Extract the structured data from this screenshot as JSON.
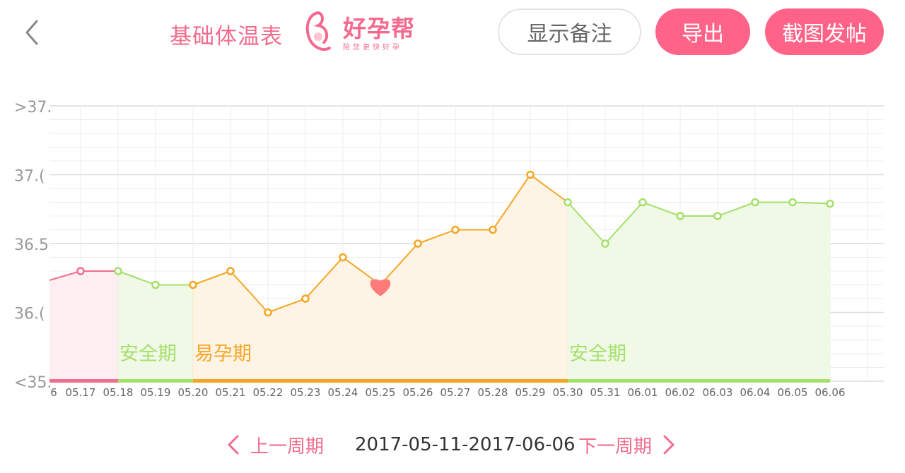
{
  "header": {
    "title": "基础体温表",
    "logo_text": "好孕帮",
    "logo_slogan": "陪您更快好孕",
    "show_notes_label": "显示备注",
    "export_label": "导出",
    "screenshot_post_label": "截图发帖"
  },
  "navigation": {
    "prev_label": "上一周期",
    "date_range": "2017-05-11-2017-06-06",
    "next_label": "下一周期"
  },
  "colors": {
    "accent": "#ff6387",
    "period": "#f06d8d",
    "safe": "#a5e06b",
    "fertile": "#f5a524",
    "heart": "#ff7a7a"
  },
  "chart_data": {
    "type": "line",
    "title": "",
    "xlabel": "",
    "ylabel": "",
    "ylim": [
      35.5,
      37.5
    ],
    "y_tick_labels": [
      ">37.",
      "37.(",
      "36.5",
      "36.(",
      "<35."
    ],
    "y_tick_values": [
      37.5,
      37.0,
      36.5,
      36.0,
      35.5
    ],
    "x_tick_labels": [
      "6",
      "05.17",
      "05.18",
      "05.19",
      "05.20",
      "05.21",
      "05.22",
      "05.23",
      "05.24",
      "05.25",
      "05.26",
      "05.27",
      "05.28",
      "05.29",
      "05.30",
      "05.31",
      "06.01",
      "06.02",
      "06.03",
      "06.04",
      "06.05",
      "06.06"
    ],
    "points": [
      {
        "date": "05.16",
        "y": 36.22,
        "phase": "period"
      },
      {
        "date": "05.17",
        "y": 36.3,
        "phase": "period"
      },
      {
        "date": "05.18",
        "y": 36.3,
        "phase": "safe"
      },
      {
        "date": "05.19",
        "y": 36.2,
        "phase": "safe"
      },
      {
        "date": "05.20",
        "y": 36.2,
        "phase": "fertile"
      },
      {
        "date": "05.21",
        "y": 36.3,
        "phase": "fertile"
      },
      {
        "date": "05.22",
        "y": 36.0,
        "phase": "fertile"
      },
      {
        "date": "05.23",
        "y": 36.1,
        "phase": "fertile"
      },
      {
        "date": "05.24",
        "y": 36.4,
        "phase": "fertile"
      },
      {
        "date": "05.25",
        "y": 36.2,
        "phase": "fertile",
        "marker": "heart"
      },
      {
        "date": "05.26",
        "y": 36.5,
        "phase": "fertile"
      },
      {
        "date": "05.27",
        "y": 36.6,
        "phase": "fertile"
      },
      {
        "date": "05.28",
        "y": 36.6,
        "phase": "fertile"
      },
      {
        "date": "05.29",
        "y": 37.0,
        "phase": "fertile"
      },
      {
        "date": "05.30",
        "y": 36.8,
        "phase": "safe"
      },
      {
        "date": "05.31",
        "y": 36.5,
        "phase": "safe"
      },
      {
        "date": "06.01",
        "y": 36.8,
        "phase": "safe"
      },
      {
        "date": "06.02",
        "y": 36.7,
        "phase": "safe"
      },
      {
        "date": "06.03",
        "y": 36.7,
        "phase": "safe"
      },
      {
        "date": "06.04",
        "y": 36.8,
        "phase": "safe"
      },
      {
        "date": "06.05",
        "y": 36.8,
        "phase": "safe"
      },
      {
        "date": "06.06",
        "y": 36.79,
        "phase": "safe"
      }
    ],
    "phases": [
      {
        "phase": "period",
        "start": "05.16",
        "end": "05.18",
        "label": ""
      },
      {
        "phase": "safe",
        "start": "05.18",
        "end": "05.20",
        "label": "安全期"
      },
      {
        "phase": "fertile",
        "start": "05.20",
        "end": "05.30",
        "label": "易孕期"
      },
      {
        "phase": "safe",
        "start": "05.30",
        "end": "06.06",
        "label": "安全期"
      }
    ],
    "grid": true,
    "legend": "none"
  }
}
